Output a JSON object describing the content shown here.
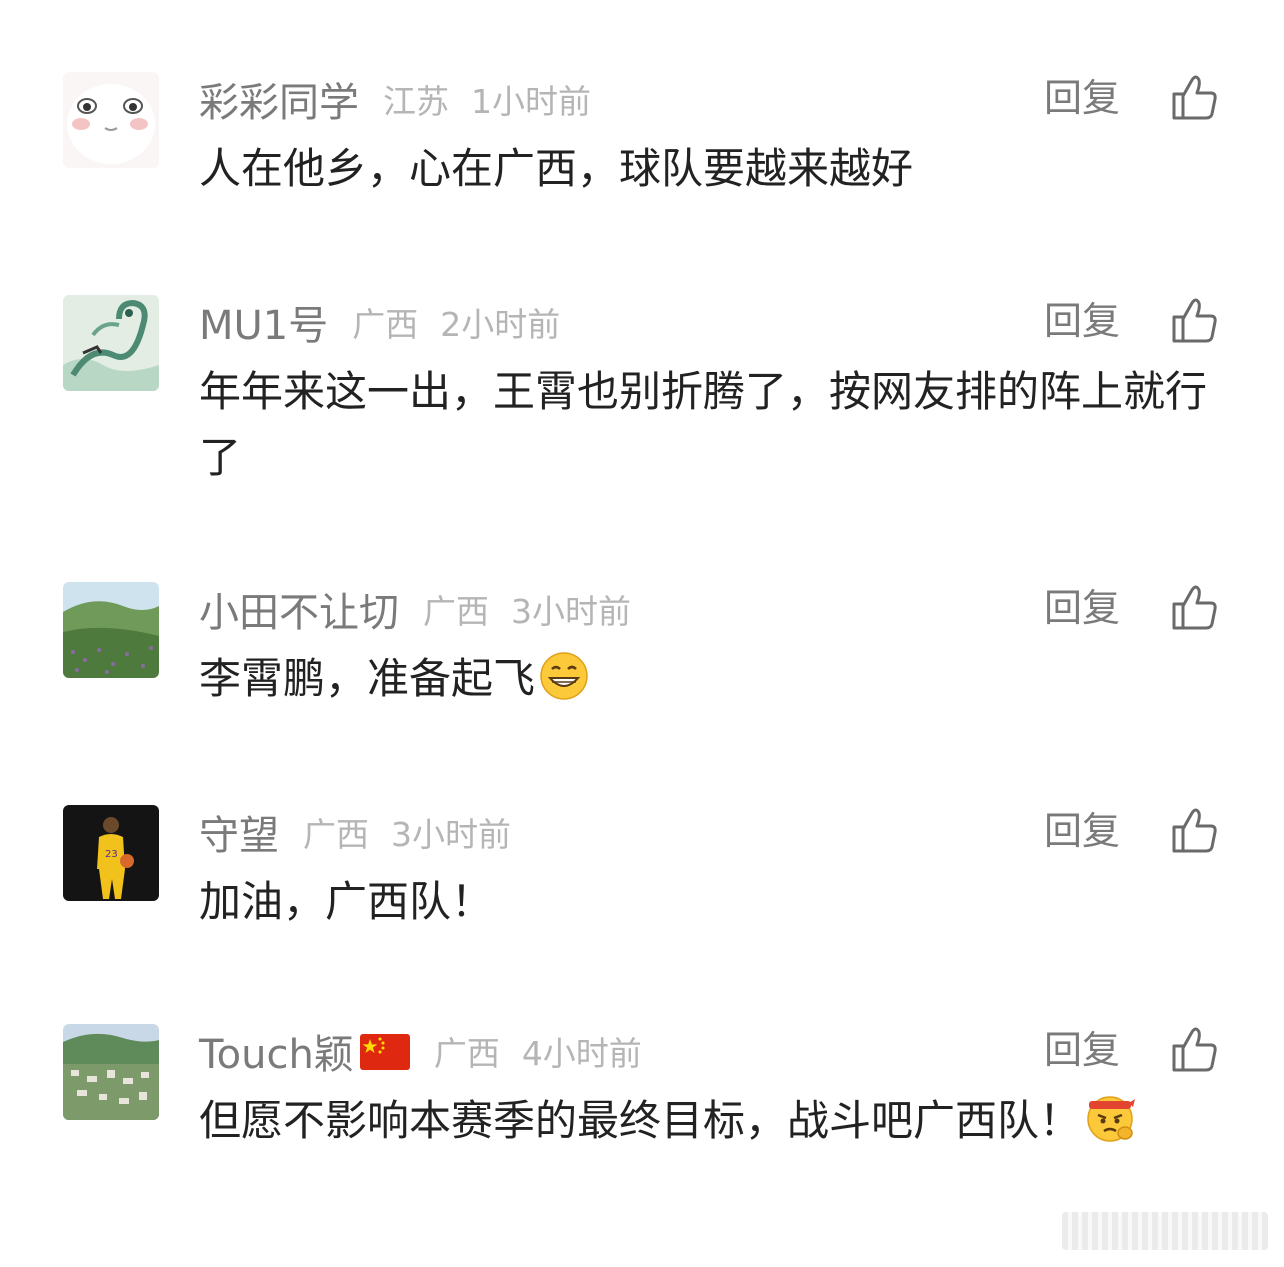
{
  "reply_label": "回复",
  "comments": [
    {
      "username": "彩彩同学",
      "location": "江苏",
      "time": "1小时前",
      "text": "人在他乡，心在广西，球队要越来越好"
    },
    {
      "username": "MU1号",
      "location": "广西",
      "time": "2小时前",
      "text": "年年来这一出，王霄也别折腾了，按网友排的阵上就行了"
    },
    {
      "username": "小田不让切",
      "location": "广西",
      "time": "3小时前",
      "text": "李霄鹏，准备起飞",
      "emoji": "grinning-face-icon"
    },
    {
      "username": "守望",
      "location": "广西",
      "time": "3小时前",
      "text": "加油，广西队！"
    },
    {
      "username": "Touch颖",
      "location": "广西",
      "time": "4小时前",
      "text": "但愿不影响本赛季的最终目标，战斗吧广西队！",
      "flag": "china-flag-icon",
      "emoji": "determined-face-icon"
    }
  ],
  "colors": {
    "username": "#7a7a7a",
    "meta": "#b5b5b5",
    "text": "#222222"
  }
}
